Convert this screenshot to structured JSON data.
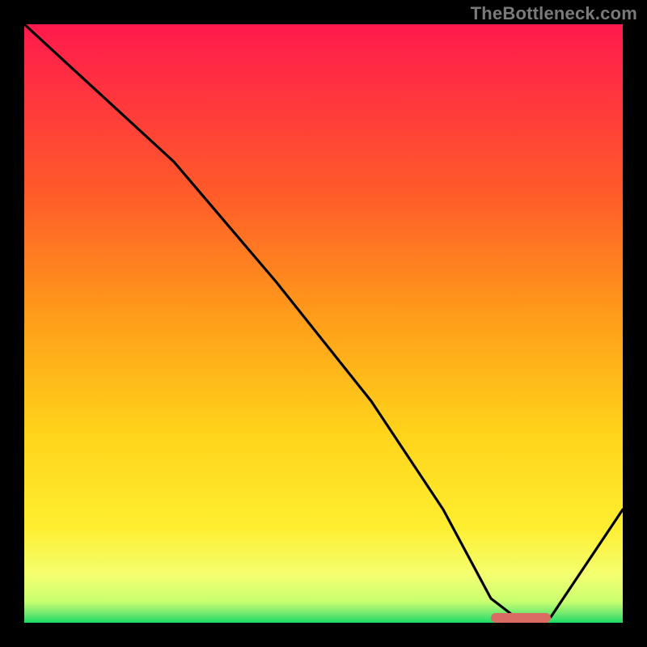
{
  "watermark": "TheBottleneck.com",
  "chart_data": {
    "type": "line",
    "title": "",
    "xlabel": "",
    "ylabel": "",
    "xlim": [
      0,
      100
    ],
    "ylim": [
      0,
      100
    ],
    "grid": false,
    "legend": false,
    "background_gradient": {
      "top_color": "#ff1a4d",
      "mid_color1": "#ff8a1a",
      "mid_color2": "#ffe31a",
      "low_color": "#f7ff66",
      "bottom_color": "#1adb66"
    },
    "series": [
      {
        "name": "bottleneck-curve",
        "type": "line",
        "color": "#000000",
        "x": [
          0,
          25,
          42,
          58,
          70,
          78,
          82,
          88,
          100
        ],
        "y": [
          100,
          77,
          57,
          37,
          19,
          4,
          1,
          1,
          19
        ]
      }
    ],
    "marker": {
      "name": "optimal-zone",
      "color": "#d96b62",
      "shape": "rounded-bar",
      "x_start": 78,
      "x_end": 88,
      "y": 0.5
    }
  }
}
